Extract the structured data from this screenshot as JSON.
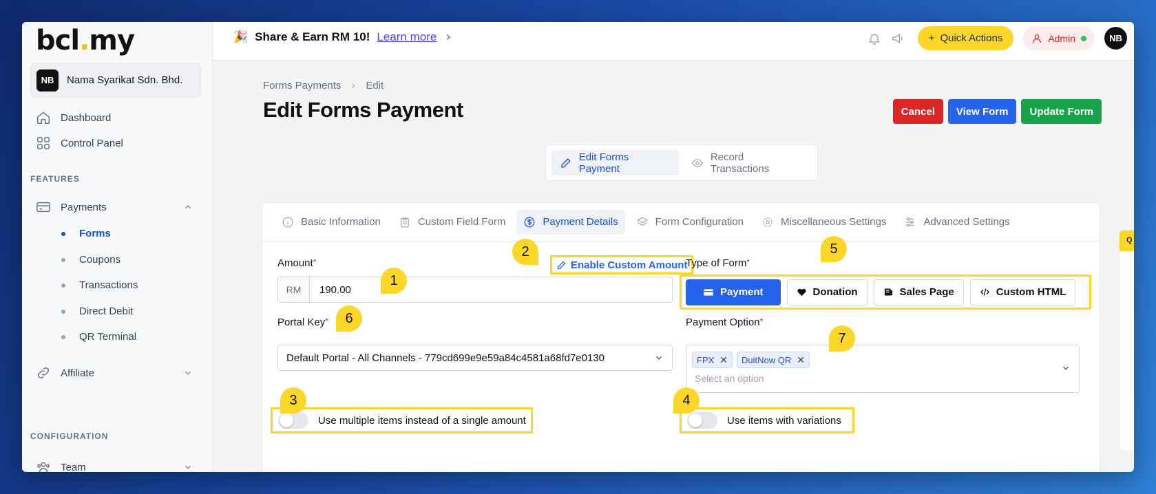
{
  "brand": {
    "logo_main": "bcl",
    "logo_dot": ".",
    "logo_tail": "my"
  },
  "company": {
    "initials": "NB",
    "name": "Nama Syarikat Sdn. Bhd."
  },
  "sidebar": {
    "dashboard": "Dashboard",
    "control_panel": "Control Panel",
    "features_label": "FEATURES",
    "payments": "Payments",
    "sub_items": [
      "Forms",
      "Coupons",
      "Transactions",
      "Direct Debit",
      "QR Terminal"
    ],
    "affiliate": "Affiliate",
    "configuration_label": "CONFIGURATION",
    "team": "Team"
  },
  "topbar": {
    "promo_emoji": "🎉",
    "promo_text": "Share & Earn RM 10!",
    "promo_link": "Learn more",
    "quick_actions": "Quick Actions",
    "admin": "Admin",
    "avatar": "NB"
  },
  "breadcrumb": {
    "parent": "Forms Payments",
    "current": "Edit"
  },
  "page": {
    "title": "Edit Forms Payment"
  },
  "actions": {
    "cancel": "Cancel",
    "view": "View Form",
    "update": "Update Form"
  },
  "top_tabs": {
    "edit": "Edit Forms Payment",
    "record": "Record Transactions"
  },
  "tabs": [
    "Basic Information",
    "Custom Field Form",
    "Payment Details",
    "Form Configuration",
    "Miscellaneous Settings",
    "Advanced Settings"
  ],
  "form": {
    "amount_label": "Amount",
    "amount_prefix": "RM",
    "amount_value": "190.00",
    "custom_amount": "Enable Custom Amount",
    "type_label": "Type of Form",
    "types": [
      "Payment",
      "Donation",
      "Sales Page",
      "Custom HTML"
    ],
    "portal_label": "Portal Key",
    "portal_value": "Default Portal - All Channels - 779cd699e9e59a84c4581a68fd7e0130",
    "payment_option_label": "Payment Option",
    "payment_chips": [
      "FPX",
      "DuitNow QR"
    ],
    "payment_placeholder": "Select an option",
    "multi_items": "Use multiple items instead of a single amount",
    "variations": "Use items with variations",
    "required_mark": "*"
  },
  "markers": [
    "1",
    "2",
    "3",
    "4",
    "5",
    "6",
    "7"
  ],
  "side_peek": "Q",
  "colors": {
    "accent": "#2563eb",
    "highlight": "#fcd72a",
    "danger": "#dc2626",
    "success": "#16a34a"
  }
}
